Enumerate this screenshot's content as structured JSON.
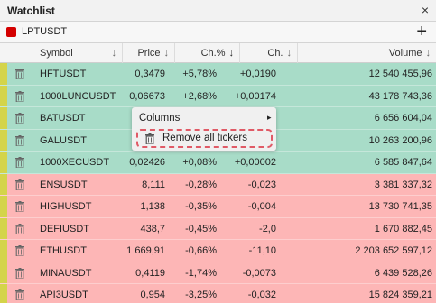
{
  "window": {
    "title": "Watchlist",
    "close_glyph": "×"
  },
  "symbol_bar": {
    "symbol": "LPTUSDT",
    "color": "#d40000",
    "add_glyph": "+"
  },
  "columns": [
    {
      "label": "Symbol"
    },
    {
      "label": "Price"
    },
    {
      "label": "Ch.%"
    },
    {
      "label": "Ch."
    },
    {
      "label": "Volume"
    }
  ],
  "rows": [
    {
      "symbol": "HFTUSDT",
      "price": "0,3479",
      "chp": "+5,78%",
      "ch": "+0,0190",
      "volume": "12 540 455,96",
      "trend": "up"
    },
    {
      "symbol": "1000LUNCUSDT",
      "price": "0,06673",
      "chp": "+2,68%",
      "ch": "+0,00174",
      "volume": "43 178 743,36",
      "trend": "up"
    },
    {
      "symbol": "BATUSDT",
      "price": "",
      "chp": "",
      "ch": "0023",
      "volume": "6 656 604,04",
      "trend": "up"
    },
    {
      "symbol": "GALUSDT",
      "price": "",
      "chp": "",
      "ch": "048",
      "volume": "10 263 200,96",
      "trend": "up"
    },
    {
      "symbol": "1000XECUSDT",
      "price": "0,02426",
      "chp": "+0,08%",
      "ch": "+0,00002",
      "volume": "6 585 847,64",
      "trend": "up"
    },
    {
      "symbol": "ENSUSDT",
      "price": "8,111",
      "chp": "-0,28%",
      "ch": "-0,023",
      "volume": "3 381 337,32",
      "trend": "down"
    },
    {
      "symbol": "HIGHUSDT",
      "price": "1,138",
      "chp": "-0,35%",
      "ch": "-0,004",
      "volume": "13 730 741,35",
      "trend": "down"
    },
    {
      "symbol": "DEFIUSDT",
      "price": "438,7",
      "chp": "-0,45%",
      "ch": "-2,0",
      "volume": "1 670 882,45",
      "trend": "down"
    },
    {
      "symbol": "ETHUSDT",
      "price": "1 669,91",
      "chp": "-0,66%",
      "ch": "-11,10",
      "volume": "2 203 652 597,12",
      "trend": "down"
    },
    {
      "symbol": "MINAUSDT",
      "price": "0,4119",
      "chp": "-1,74%",
      "ch": "-0,0073",
      "volume": "6 439 528,26",
      "trend": "down"
    },
    {
      "symbol": "API3USDT",
      "price": "0,954",
      "chp": "-3,25%",
      "ch": "-0,032",
      "volume": "15 824 359,21",
      "trend": "down"
    }
  ],
  "context_menu": {
    "columns_label": "Columns",
    "remove_label": "Remove all tickers"
  },
  "colors": {
    "up_row": "#a8dcc8",
    "down_row": "#fdb6b6",
    "stripe": "#d4d44a",
    "highlight": "#e05a66"
  }
}
